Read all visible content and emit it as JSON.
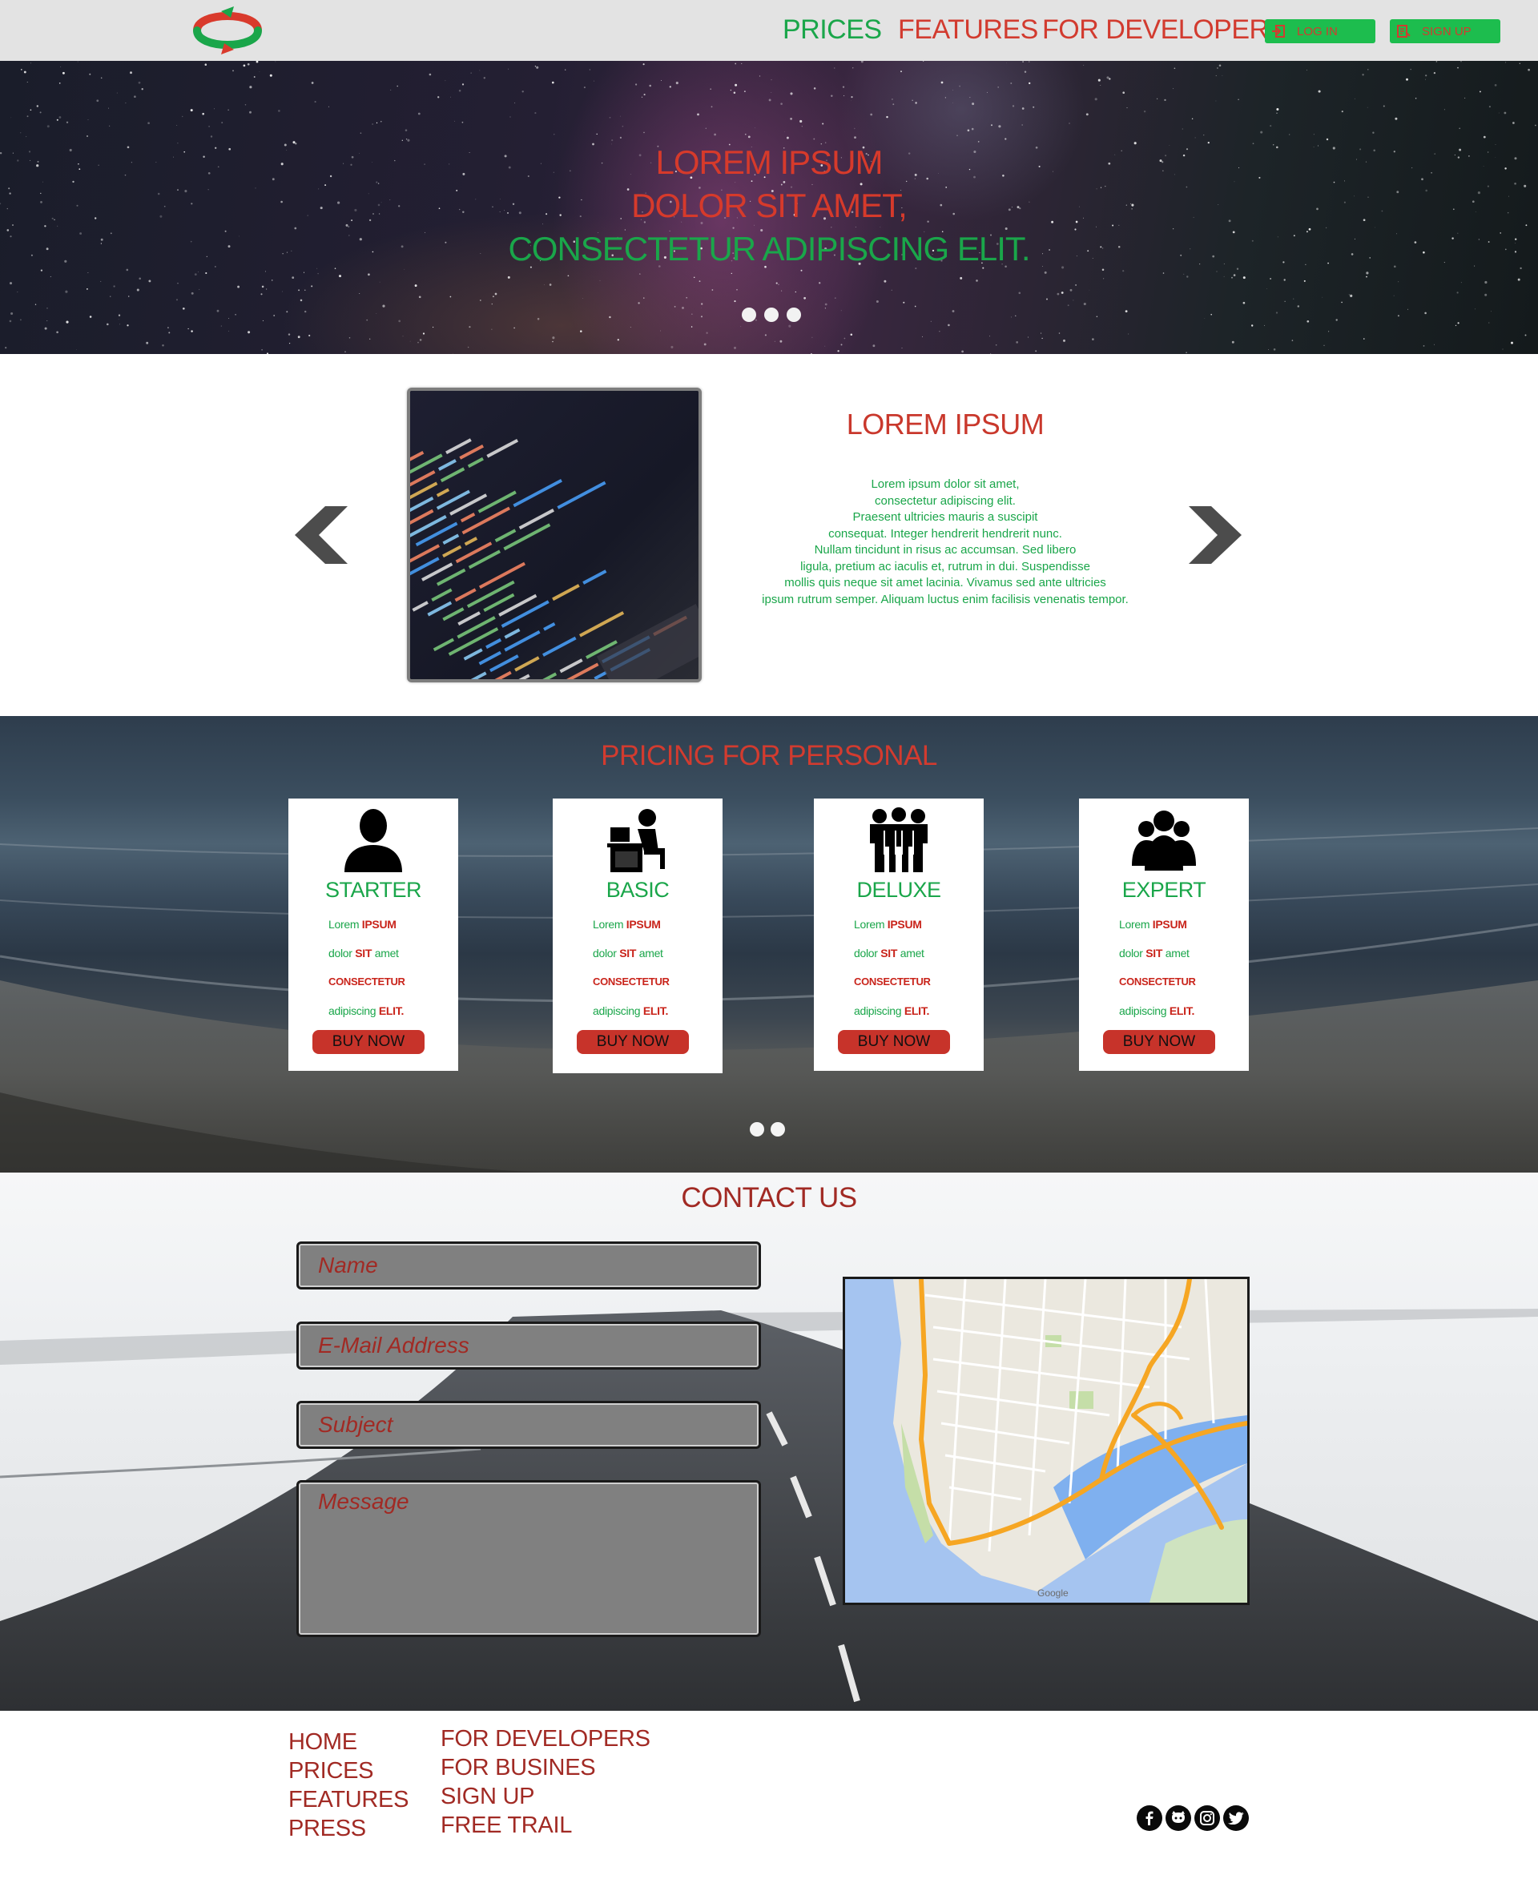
{
  "header": {
    "nav": {
      "prices": "PRICES",
      "features": "FEATURES",
      "developers": "FOR DEVELOPERS"
    },
    "login_label": "LOG IN",
    "signup_label": "SIGN UP"
  },
  "hero": {
    "line1": "LOREM IPSUM",
    "line2": "DOLOR SIT AMET,",
    "line3": "CONSECTETUR ADIPISCING ELIT."
  },
  "feature": {
    "title": "LOREM IPSUM",
    "text_lines": [
      "Lorem ipsum dolor sit amet,",
      "consectetur adipiscing elit.",
      "Praesent ultricies mauris a suscipit",
      "consequat. Integer hendrerit hendrerit nunc.",
      "Nullam tincidunt in risus ac accumsan. Sed libero",
      "ligula, pretium ac iaculis et, rutrum in dui. Suspendisse",
      "mollis quis neque sit amet lacinia. Vivamus sed ante ultricies",
      "ipsum rutrum semper. Aliquam luctus enim facilisis venenatis tempor."
    ]
  },
  "pricing": {
    "title": "PRICING FOR PERSONAL",
    "card_lines": {
      "l1a": "Lorem ",
      "l1b": "IPSUM",
      "l2a": "dolor ",
      "l2b": "SIT",
      "l2c": " amet",
      "l3": "CONSECTETUR",
      "l4a": "adipiscing ",
      "l4b": "ELIT."
    },
    "buy_label": "BUY NOW",
    "plans": [
      {
        "name": "STARTER",
        "icon": "person-icon"
      },
      {
        "name": "BASIC",
        "icon": "person-at-desk-icon"
      },
      {
        "name": "DELUXE",
        "icon": "group-hugging-icon"
      },
      {
        "name": "EXPERT",
        "icon": "team-icon"
      }
    ]
  },
  "contact": {
    "title": "CONTACT US",
    "name_placeholder": "Name",
    "email_placeholder": "E-Mail Address",
    "subject_placeholder": "Subject",
    "message_placeholder": "Message",
    "map_brand": "Google"
  },
  "footer": {
    "col1": [
      "HOME",
      "PRICES",
      "FEATURES",
      "PRESS"
    ],
    "col2": [
      "FOR DEVELOPERS",
      "FOR BUSINES",
      "SIGN UP",
      "FREE TRAIL"
    ],
    "social": [
      "facebook-icon",
      "github-icon",
      "instagram-icon",
      "twitter-icon"
    ]
  },
  "colors": {
    "accent_green": "#1aa64a",
    "accent_red": "#d23b2f",
    "header_bg": "#e3e3e3"
  }
}
